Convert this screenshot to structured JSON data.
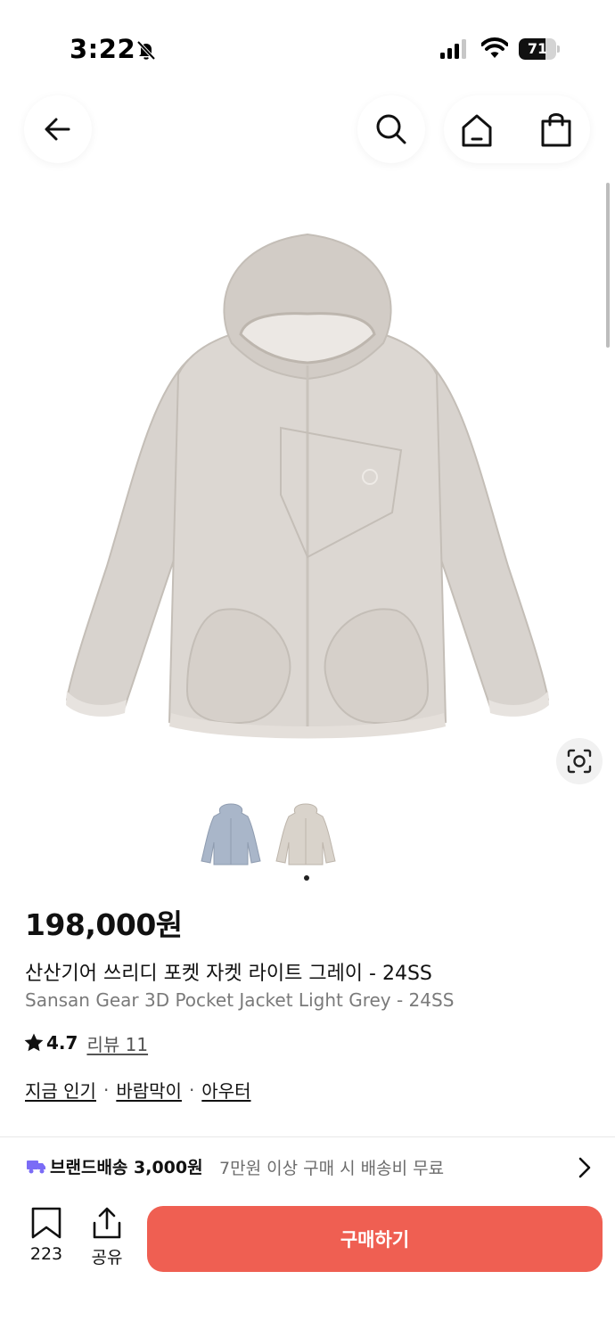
{
  "status_bar": {
    "time": "3:22",
    "battery": "71",
    "battery_level": 0.71,
    "icons": [
      "bell-slash-icon",
      "signal-icon",
      "wifi-icon",
      "battery-icon"
    ]
  },
  "nav": {
    "icons": [
      "back-arrow-icon",
      "search-icon",
      "home-icon",
      "shopping-bag-icon"
    ]
  },
  "gallery": {
    "image_count": 2,
    "active_index": 1,
    "colors": [
      "#a9b6c9",
      "#d9d3cb"
    ]
  },
  "product": {
    "price": "198,000원",
    "title_ko": "산산기어 쓰리디 포켓 자켓 라이트 그레이 - 24SS",
    "title_en": "Sansan Gear 3D Pocket Jacket Light Grey - 24SS",
    "rating": "4.7",
    "review_label": "리뷰 11",
    "tags": [
      "지금 인기",
      "바람막이",
      "아우터"
    ],
    "tag_separator": "·"
  },
  "shipping": {
    "label": "브랜드배송 3,000원",
    "note": "7만원 이상 구매 시 배송비 무료",
    "truck_color": "#7b6cf6"
  },
  "bottom_bar": {
    "bookmark_count": "223",
    "share_label": "공유",
    "buy_label": "구매하기",
    "buy_color": "#ef5f52"
  }
}
